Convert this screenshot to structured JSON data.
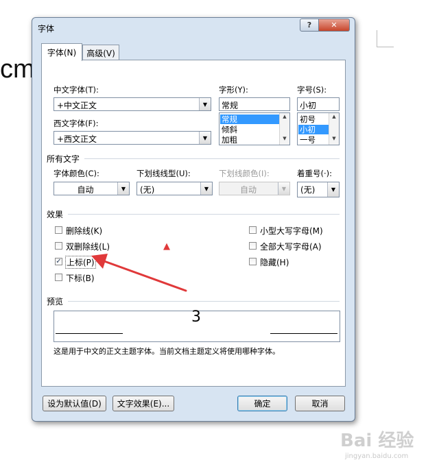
{
  "background": {
    "doc_text": "cm"
  },
  "dialog": {
    "title": "字体",
    "help_label": "?",
    "close_label": "✕",
    "tabs": [
      {
        "label": "字体(N)",
        "active": true
      },
      {
        "label": "高级(V)",
        "active": false
      }
    ],
    "chinese_font": {
      "label": "中文字体(T):",
      "value": "+中文正文"
    },
    "western_font": {
      "label": "西文字体(F):",
      "value": "+西文正文"
    },
    "style": {
      "label": "字形(Y):",
      "value": "常规",
      "options": [
        "常规",
        "倾斜",
        "加粗"
      ],
      "selected": "常规"
    },
    "size": {
      "label": "字号(S):",
      "value": "小初",
      "options": [
        "初号",
        "小初",
        "一号"
      ],
      "selected": "小初"
    },
    "all_text": {
      "title": "所有文字",
      "font_color": {
        "label": "字体颜色(C):",
        "value": "自动"
      },
      "underline_style": {
        "label": "下划线线型(U):",
        "value": "(无)"
      },
      "underline_color": {
        "label": "下划线颜色(I):",
        "value": "自动"
      },
      "emphasis": {
        "label": "着重号(·):",
        "value": "(无)"
      }
    },
    "effects": {
      "title": "效果",
      "left": [
        {
          "label": "删除线(K)",
          "checked": false
        },
        {
          "label": "双删除线(L)",
          "checked": false
        },
        {
          "label": "上标(P)",
          "checked": true
        },
        {
          "label": "下标(B)",
          "checked": false
        }
      ],
      "right": [
        {
          "label": "小型大写字母(M)",
          "checked": false
        },
        {
          "label": "全部大写字母(A)",
          "checked": false
        },
        {
          "label": "隐藏(H)",
          "checked": false
        }
      ]
    },
    "preview": {
      "title": "预览",
      "sample": "3",
      "description": "这是用于中文的正文主题字体。当前文档主题定义将使用哪种字体。"
    },
    "buttons": {
      "set_default": "设为默认值(D)",
      "text_effects": "文字效果(E)...",
      "ok": "确定",
      "cancel": "取消"
    },
    "check_mark": "✓",
    "arrow_glyph": "▼"
  },
  "annotation": {
    "color": "#e0393a"
  },
  "watermark": {
    "brand": "Bai 经验",
    "url": "jingyan.baidu.com"
  }
}
